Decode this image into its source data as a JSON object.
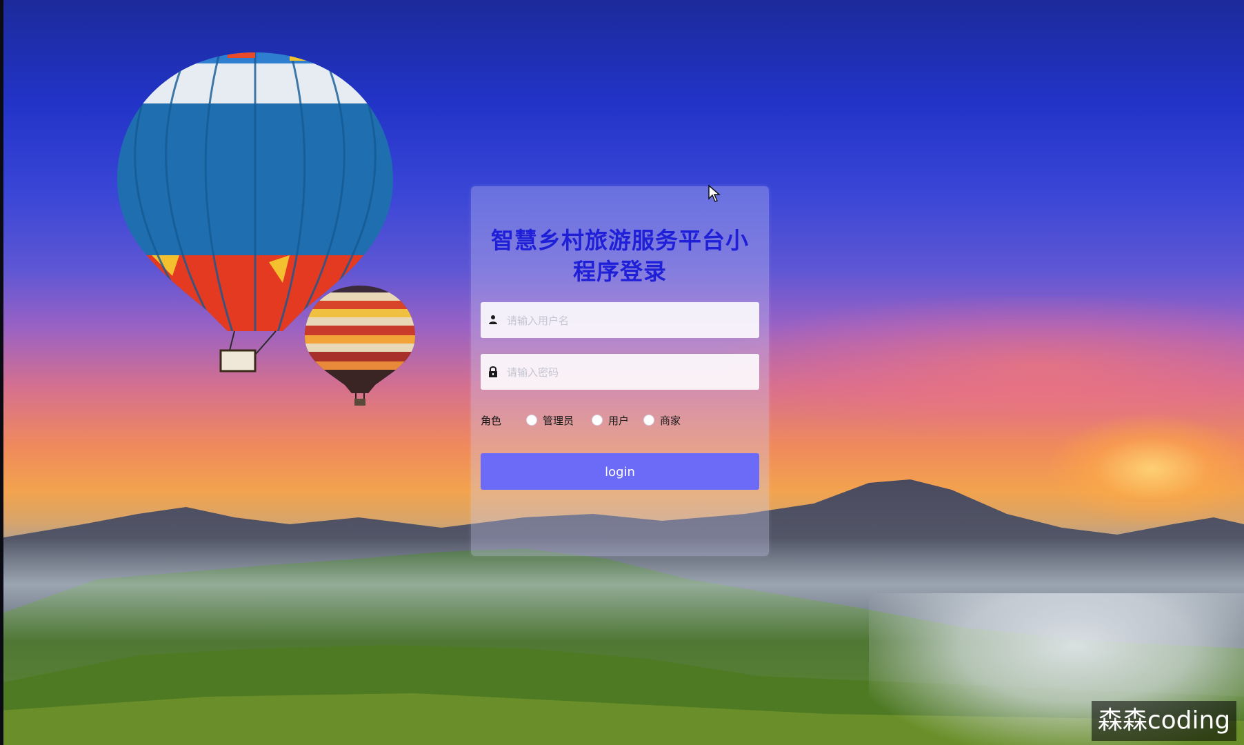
{
  "login": {
    "title": "智慧乡村旅游服务平台小程序登录",
    "username_placeholder": "请输入用户名",
    "password_placeholder": "请输入密码",
    "role_label": "角色",
    "roles": [
      "管理员",
      "用户",
      "商家"
    ],
    "submit_label": "login"
  },
  "icons": {
    "username": "user-icon",
    "password": "lock-icon"
  },
  "colors": {
    "title": "#1f1fd8",
    "button": "#6b6bf7"
  },
  "watermark": "森森coding"
}
